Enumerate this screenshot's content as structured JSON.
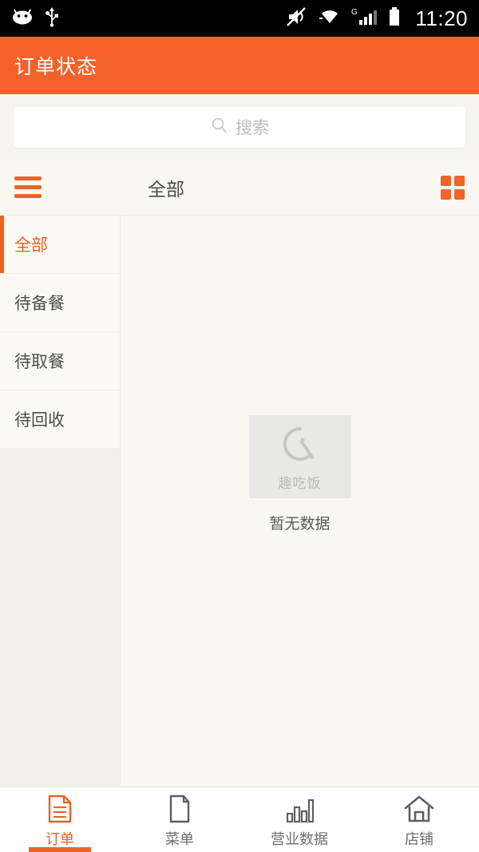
{
  "statusbar": {
    "time": "11:20",
    "icons": [
      "android-robot-icon",
      "usb-icon",
      "volume-muted-icon",
      "wifi-icon",
      "cellular-signal-icon",
      "battery-icon"
    ],
    "network_label": "G",
    "background": "#000000"
  },
  "appbar": {
    "title": "订单状态",
    "background": "#f2622a"
  },
  "search": {
    "placeholder": "搜索",
    "value": ""
  },
  "toolbar": {
    "title": "全部",
    "menu_icon": "hamburger-icon",
    "grid_icon": "grid-view-icon"
  },
  "sidebar": {
    "items": [
      {
        "label": "全部",
        "active": true
      },
      {
        "label": "待备餐",
        "active": false
      },
      {
        "label": "待取餐",
        "active": false
      },
      {
        "label": "待回收",
        "active": false
      }
    ]
  },
  "content": {
    "empty_logo_text": "趣吃饭",
    "empty_text": "暂无数据"
  },
  "bottomnav": {
    "items": [
      {
        "label": "订单",
        "icon": "order-document-icon",
        "active": true
      },
      {
        "label": "菜单",
        "icon": "menu-page-icon",
        "active": false
      },
      {
        "label": "营业数据",
        "icon": "bar-chart-icon",
        "active": false
      },
      {
        "label": "店铺",
        "icon": "home-store-icon",
        "active": false
      }
    ]
  },
  "colors": {
    "accent": "#ee6127",
    "appbar": "#f2622a",
    "page_bg": "#f8f7f2",
    "text": "#4d4d4d"
  }
}
